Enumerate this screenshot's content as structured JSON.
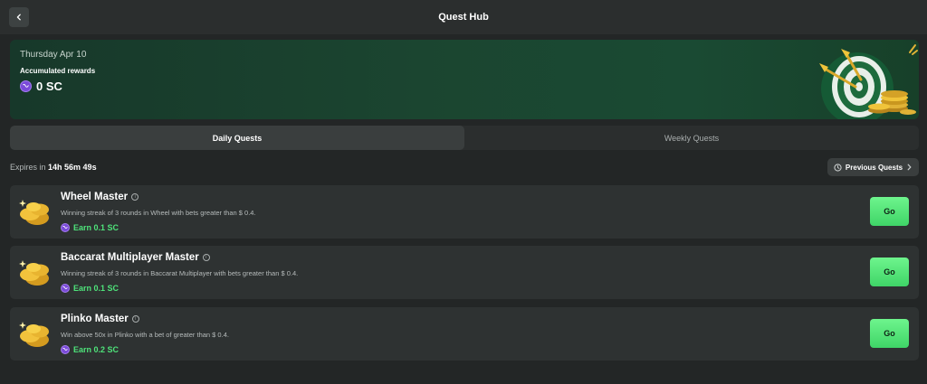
{
  "header": {
    "title": "Quest Hub",
    "back_icon": "chevron-left-icon"
  },
  "banner": {
    "date": "Thursday Apr 10",
    "label": "Accumulated rewards",
    "amount": "0 SC",
    "coin_icon": "sc-coin-icon",
    "art": "dartboard-gold-coins-illustration"
  },
  "tabs": [
    {
      "label": "Daily Quests",
      "active": true
    },
    {
      "label": "Weekly Quests",
      "active": false
    }
  ],
  "expires": {
    "prefix": "Expires in",
    "time": "14h 56m 49s"
  },
  "previous_quests": {
    "label": "Previous Quests",
    "icon": "history-clock-icon",
    "chevron": "chevron-right-icon"
  },
  "quests": [
    {
      "title": "Wheel Master",
      "description": "Winning streak of 3 rounds in Wheel with bets greater than $ 0.4.",
      "reward": "Earn 0.1 SC",
      "button": "Go"
    },
    {
      "title": "Baccarat Multiplayer Master",
      "description": "Winning streak of 3 rounds in Baccarat Multiplayer with bets greater than $ 0.4.",
      "reward": "Earn 0.1 SC",
      "button": "Go"
    },
    {
      "title": "Plinko Master",
      "description": "Win above 50x in Plinko with a bet of greater than $ 0.4.",
      "reward": "Earn 0.2 SC",
      "button": "Go"
    }
  ],
  "colors": {
    "background": "#232626",
    "panel": "#2e3232",
    "accent_green": "#4ee37a",
    "button_green": "#5fe880",
    "sc_purple": "#7a4ad8",
    "banner_green": "#1b4530"
  }
}
